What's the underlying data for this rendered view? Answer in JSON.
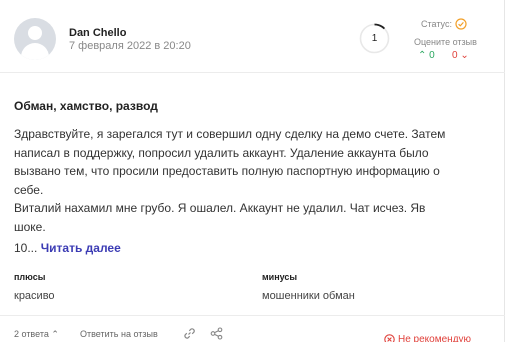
{
  "review": {
    "author": "Dan Chello",
    "date": "7 февраля 2022 в 20:20",
    "rating": "1",
    "status_label": "Статус:",
    "rate_label": "Оцените отзыв",
    "votes_up": "0",
    "votes_down": "0",
    "title": "Обман, хамство, развод",
    "text_lines": [
      "Здравствуйте, я зарегался тут и совершил одну сделку на демо счете. Затем",
      "написал в поддержку, попросил удалить аккаунт. Удаление аккаунта было",
      "вызвано тем, что просили предоставить полную паспортную информацию о",
      "себе.",
      "Виталий нахамил мне грубо. Я ошалел. Аккаунт не удалил. Чат исчез. Яв",
      "шоке."
    ],
    "text_tail": "10...",
    "read_more": "Читать далее",
    "pros_label": "плюсы",
    "pros": "красиво",
    "cons_label": "минусы",
    "cons": "мошенники обман",
    "replies": "2 ответа",
    "reply_button": "Ответить на отзыв",
    "not_recommend": "Не рекомендую"
  },
  "colors": {
    "accent": "#3c3cb4",
    "positive": "#2aa860",
    "negative": "#e0413b",
    "status": "#f2a02a"
  },
  "icons": [
    "user-avatar-icon",
    "status-icon",
    "thumb-up-icon",
    "thumb-down-icon",
    "chevron-up-icon",
    "link-icon",
    "share-icon",
    "not-recommend-icon"
  ]
}
